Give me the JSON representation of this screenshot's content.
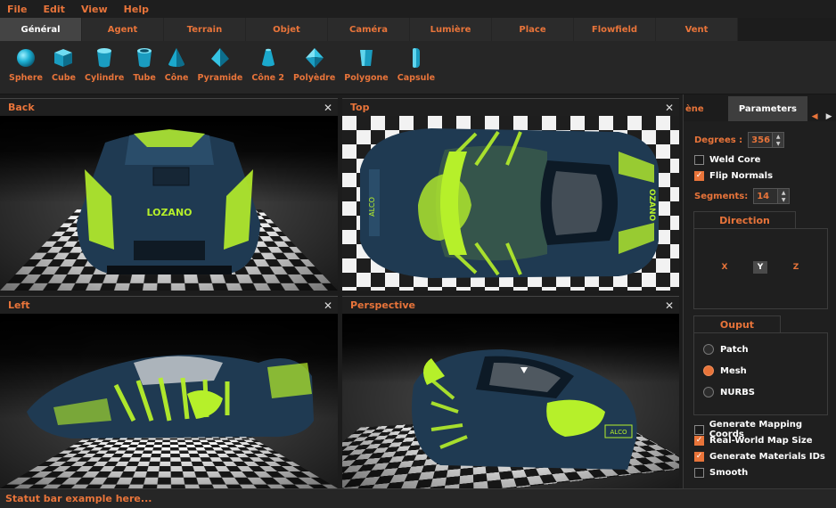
{
  "menu": [
    "File",
    "Edit",
    "View",
    "Help"
  ],
  "tabs": [
    "Général",
    "Agent",
    "Terrain",
    "Objet",
    "Caméra",
    "Lumière",
    "Place",
    "Flowfield",
    "Vent"
  ],
  "tools": [
    {
      "label": "Sphere",
      "icon": "sphere-icon"
    },
    {
      "label": "Cube",
      "icon": "cube-icon"
    },
    {
      "label": "Cylindre",
      "icon": "cylinder-icon"
    },
    {
      "label": "Tube",
      "icon": "tube-icon"
    },
    {
      "label": "Cône",
      "icon": "cone-icon"
    },
    {
      "label": "Pyramide",
      "icon": "pyramid-icon"
    },
    {
      "label": "Cône 2",
      "icon": "cone2-icon"
    },
    {
      "label": "Polyèdre",
      "icon": "polyhedron-icon"
    },
    {
      "label": "Polygone",
      "icon": "polygon-icon"
    },
    {
      "label": "Capsule",
      "icon": "capsule-icon"
    }
  ],
  "viewports": {
    "back": {
      "title": "Back",
      "close": "✕"
    },
    "top": {
      "title": "Top",
      "close": "✕"
    },
    "left": {
      "title": "Left",
      "close": "✕"
    },
    "perspective": {
      "title": "Perspective",
      "close": "✕"
    }
  },
  "car_text": {
    "logo": "LOZANO",
    "plate": "ALCO",
    "side": "OZANO"
  },
  "panel": {
    "tab_scene": "ène",
    "tab_params": "Parameters",
    "degrees_label": "Degrees :",
    "degrees_value": "356",
    "weld_core": "Weld Core",
    "flip_normals": "Flip Normals",
    "segments_label": "Segments:",
    "segments_value": "14",
    "direction_title": "Direction",
    "axis_x": "X",
    "axis_y": "Y",
    "axis_z": "Z",
    "output_title": "Ouput",
    "patch": "Patch",
    "mesh": "Mesh",
    "nurbs": "NURBS",
    "gen_mapping": "Generate Mapping Coords",
    "real_world": "Real-World Map Size",
    "gen_materials": "Generate Materials IDs",
    "smooth": "Smooth"
  },
  "checks": {
    "weld_core": false,
    "flip_normals": true,
    "gen_mapping": false,
    "real_world": true,
    "gen_materials": true,
    "smooth": false
  },
  "output_selected": "Mesh",
  "direction_selected": "Y",
  "status": "Statut bar example here...",
  "colors": {
    "accent": "#e8743a",
    "car_body": "#1f3a52",
    "car_livery": "#b6f02a"
  }
}
